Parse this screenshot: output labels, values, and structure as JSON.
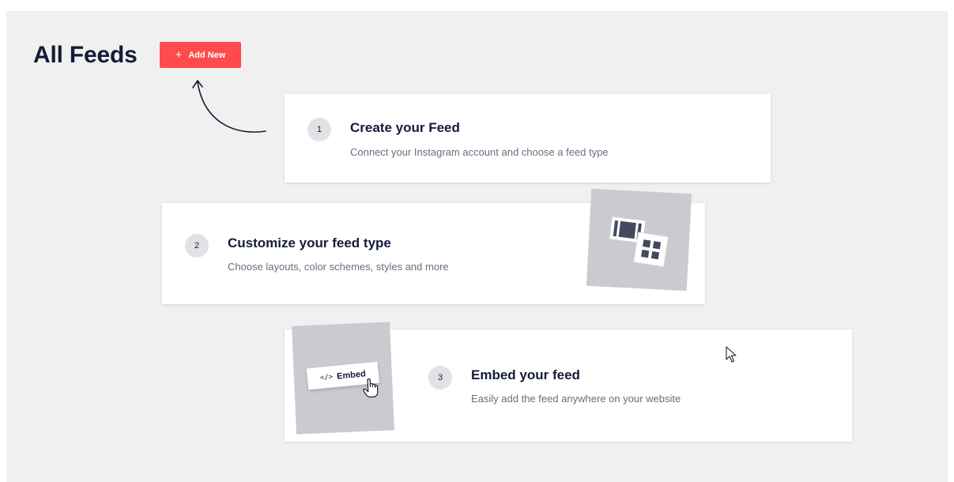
{
  "header": {
    "title": "All Feeds",
    "add_button_label": "Add New",
    "add_button_icon": "plus-icon",
    "accent_color": "#ff4b4b"
  },
  "steps": [
    {
      "number": "1",
      "title": "Create your Feed",
      "description": "Connect your Instagram account and choose a feed type"
    },
    {
      "number": "2",
      "title": "Customize your feed type",
      "description": "Choose layouts, color schemes, styles and more",
      "illustration": "layout-grid-icon"
    },
    {
      "number": "3",
      "title": "Embed your feed",
      "description": "Easily add the feed anywhere on your website",
      "illustration": "embed-button-icon",
      "illustration_label": "Embed",
      "illustration_code": "</>"
    }
  ]
}
